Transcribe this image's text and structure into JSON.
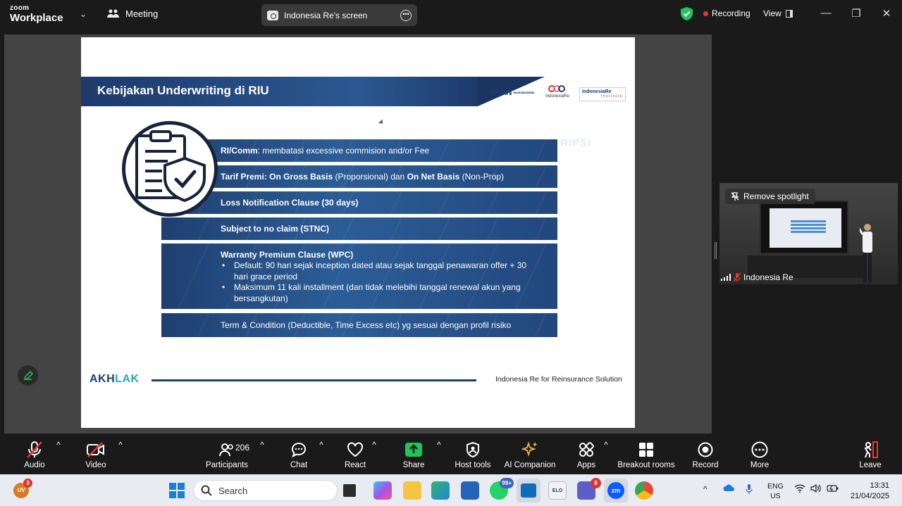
{
  "topbar": {
    "logo_line1": "zoom",
    "logo_line2": "Workplace",
    "meeting_label": "Meeting",
    "screen_label": "Indonesia Re's screen",
    "recording_label": "Recording",
    "view_label": "View"
  },
  "slide": {
    "title": "Kebijakan Underwriting di RIU",
    "logos": {
      "bumn": "BUMN",
      "bumn_sub": "UNTUK INDONESIA",
      "indonesia_re": "IndonesiaRe",
      "institute": "IndonesiaRe",
      "institute_sub": "Institute"
    },
    "watermark": "RIPSI",
    "rows": [
      {
        "bold": "RI/Comm",
        "text": ": membatasi excessive commision and/or Fee"
      },
      {
        "bold": "Tarif Premi: On Gross Basis",
        "text": " (Proporsional) dan ",
        "bold2": "On Net Basis",
        "text2": " (Non-Prop)"
      },
      {
        "bold": "Loss Notification Clause (30 days)"
      },
      {
        "bold": "Subject to no claim (STNC)"
      },
      {
        "bold": "Warranty Premium Clause (WPC)",
        "bullets": [
          "Default: 90 hari sejak inception dated atau sejak tanggal penawaran offer + 30 hari grace period",
          "Maksimum 11 kali installment (dan tidak melebihi tanggal renewal akun yang bersangkutan)"
        ]
      },
      {
        "text": "Term & Condition (Deductible, Time Excess etc) yg sesuai dengan profil risiko"
      }
    ],
    "footer_brand": "AKHLAK",
    "footer_text": "Indonesia Re for Reinsurance Solution"
  },
  "video": {
    "spotlight_label": "Remove spotlight",
    "name": "Indonesia Re"
  },
  "toolbar": {
    "audio": "Audio",
    "video": "Video",
    "participants": "Participants",
    "participants_count": "206",
    "chat": "Chat",
    "react": "React",
    "share": "Share",
    "host_tools": "Host tools",
    "ai_companion": "AI Companion",
    "apps": "Apps",
    "breakout_rooms": "Breakout rooms",
    "record": "Record",
    "more": "More",
    "leave": "Leave"
  },
  "taskbar": {
    "weather_badge": "3",
    "weather_abbr": "UV",
    "search_placeholder": "Search",
    "whatsapp_badge": "99+",
    "teams_badge": "8",
    "lang_line1": "ENG",
    "lang_line2": "US",
    "time": "13:31",
    "date": "21/04/2025"
  },
  "colors": {
    "slide_blue": "#1f3f70",
    "accent_teal": "#2fa3c7",
    "share_green": "#22c35b",
    "recording_red": "#e33333",
    "leave_red": "#e33333"
  }
}
